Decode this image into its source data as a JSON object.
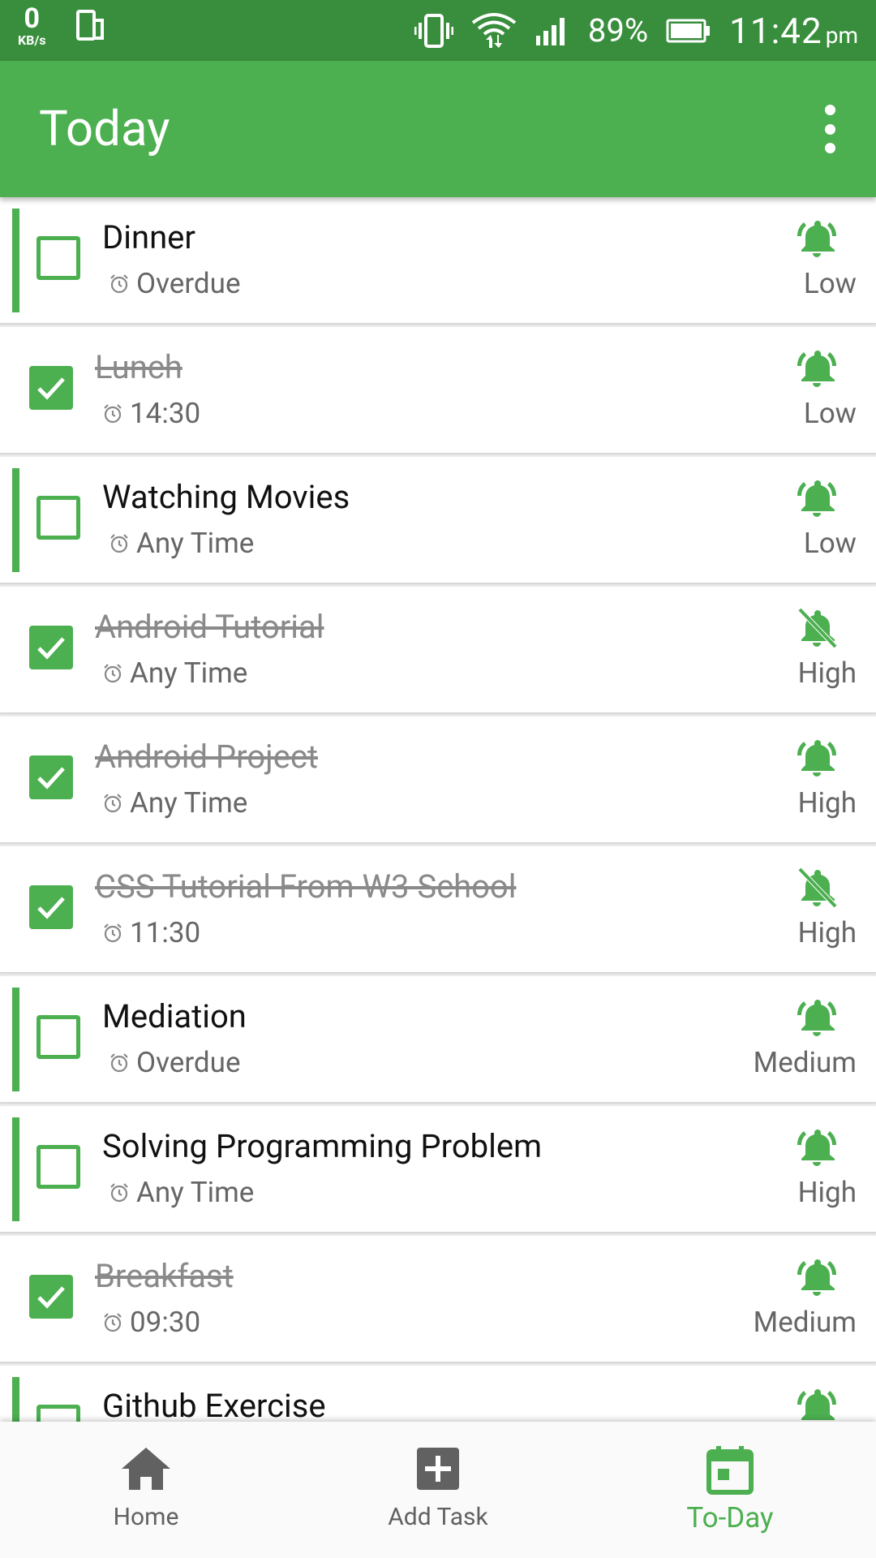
{
  "status_bar": {
    "net_speed": "0",
    "net_unit": "KB/s",
    "battery": "89%",
    "time": "11:42",
    "ampm": "pm"
  },
  "app_bar": {
    "title": "Today"
  },
  "colors": {
    "primary": "#4caf50",
    "primary_dark": "#388e3c"
  },
  "tasks": [
    {
      "title": "Dinner",
      "time": "Overdue",
      "priority": "Low",
      "done": false,
      "alarm": "on"
    },
    {
      "title": "Lunch",
      "time": "14:30",
      "priority": "Low",
      "done": true,
      "alarm": "on"
    },
    {
      "title": "Watching Movies",
      "time": "Any Time",
      "priority": "Low",
      "done": false,
      "alarm": "on"
    },
    {
      "title": "Android Tutorial",
      "time": "Any Time",
      "priority": "High",
      "done": true,
      "alarm": "off"
    },
    {
      "title": "Android Project",
      "time": "Any Time",
      "priority": "High",
      "done": true,
      "alarm": "on"
    },
    {
      "title": "CSS Tutorial From W3 School",
      "time": "11:30",
      "priority": "High",
      "done": true,
      "alarm": "off"
    },
    {
      "title": "Mediation",
      "time": "Overdue",
      "priority": "Medium",
      "done": false,
      "alarm": "on"
    },
    {
      "title": "Solving Programming Problem",
      "time": "Any Time",
      "priority": "High",
      "done": false,
      "alarm": "on"
    },
    {
      "title": "Breakfast",
      "time": "09:30",
      "priority": "Medium",
      "done": true,
      "alarm": "on"
    },
    {
      "title": "Github Exercise",
      "time": "",
      "priority": "",
      "done": false,
      "alarm": "on"
    }
  ],
  "bottom_nav": {
    "items": [
      {
        "label": "Home",
        "icon": "home-icon",
        "active": false
      },
      {
        "label": "Add Task",
        "icon": "add-box-icon",
        "active": false
      },
      {
        "label": "To-Day",
        "icon": "calendar-today-icon",
        "active": true
      }
    ]
  }
}
